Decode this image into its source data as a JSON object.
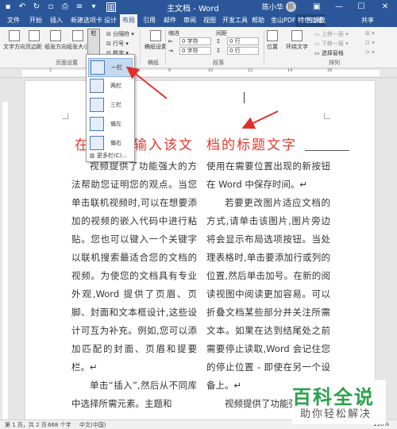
{
  "window": {
    "title": "主文档 - Word",
    "user": "陈小华",
    "avatar": "陈",
    "qat": [
      "save-icon",
      "undo-icon",
      "redo-icon",
      "new-icon",
      "print-icon",
      "list-icon"
    ],
    "controls": {
      "minimize": "—",
      "restore": "☐",
      "close": "✕",
      "ribbon_opts": "▣"
    }
  },
  "tabs": [
    "文件",
    "开始",
    "插入",
    "新建选项卡",
    "设计",
    "布局",
    "引用",
    "邮件",
    "审阅",
    "视图",
    "开发工具",
    "帮助",
    "金山PDF",
    "特色功能"
  ],
  "active_tab": "布局",
  "tell_me": "告诉我",
  "share": "共享",
  "ribbon": {
    "page_setup": {
      "label": "页面设置",
      "buttons": [
        "文字方向",
        "页边距",
        "纸张方向",
        "纸张大小"
      ],
      "columns": "栏",
      "breaks": "分隔符",
      "line_numbers": "行号",
      "hyphenation": "断字"
    },
    "manuscript": {
      "button": "稿纸设置",
      "label": "稿纸"
    },
    "paragraph": {
      "indent": "缩进",
      "spacing": "间距",
      "left_label": "0 字符",
      "right_label": "0 字符",
      "before": "0 行",
      "after": "0 行",
      "label": "段落"
    },
    "position": "位置",
    "wrap": "环绕文字",
    "arrange": {
      "forward": "上移一层",
      "backward": "下移一层",
      "select_pane": "选择窗格",
      "label": "排列"
    }
  },
  "dropdown": {
    "items": [
      "一栏",
      "两栏",
      "三栏",
      "偏左",
      "偏右"
    ],
    "selected_index": 0,
    "more": "更多栏(C)..."
  },
  "document": {
    "heading_left": "在",
    "heading_mid": "输入该文",
    "heading_right": "档的标题文字",
    "col1": [
      "视频提供了功能强大的方法帮助您证明您的观点。当您单击联机视频时,可以在想要添加的视频的嵌入代码中进行粘贴。您也可以键入一个关键字以联机搜索最适合您的文档的视频。为使您的文档具有专业外观,Word 提供了页眉、页脚、封面和文本框设计,这些设计可互为补充。例如,您可以添加匹配的封面、页眉和提要栏。↵",
      "单击“插入”,然后从不同库中选择所需元素。主题和"
    ],
    "col2": [
      "使用在需要位置出现的新按钮在 Word 中保存时间。↵",
      "若要更改图片适应文档的方式,请单击该图片,图片旁边将会显示布局选项按钮。当处理表格时,单击要添加行或列的位置,然后单击加号。在新的阅读视图中阅读更加容易。可以折叠文档某些部分并关注所需文本。如果在达到结尾处之前需要停止读取,Word 会记住您的停止位置 - 即使在另一个设备上。↵",
      "视频提供了功能强大"
    ]
  },
  "status": {
    "page": "第 1 页，共 2 页",
    "words": "668 个字",
    "lang": "中文(中国)",
    "zoom": "110%"
  },
  "watermark": {
    "title": "百科全说",
    "subtitle": "助你轻松解决"
  },
  "colors": {
    "accent": "#2b579a",
    "heading": "#e8382d",
    "arrow": "#e0302a",
    "watermark": "#2aa14b"
  }
}
